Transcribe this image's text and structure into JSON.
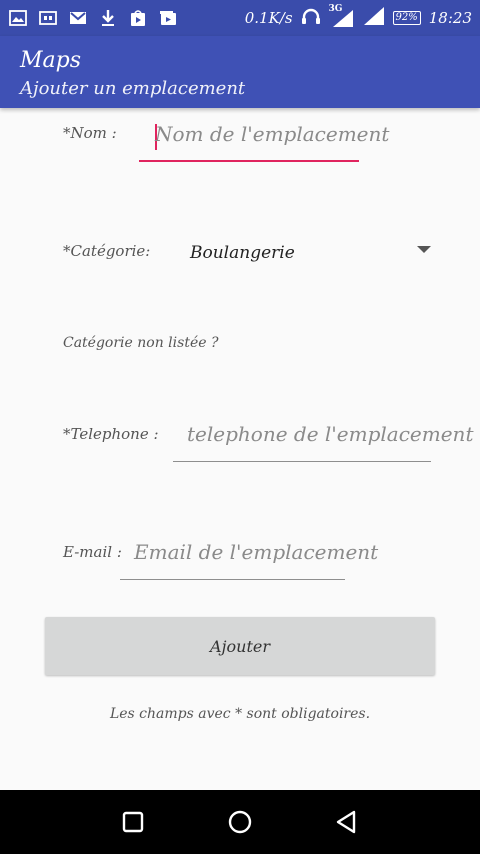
{
  "status_bar": {
    "network_speed": "0.1K/s",
    "network_type": "3G",
    "battery": "92%",
    "time": "18:23",
    "icons": [
      "image-icon",
      "cast-icon",
      "gmail-icon",
      "download-icon",
      "store-icon",
      "gallery-icon",
      "headphones-icon",
      "signal-icon",
      "signal-icon-2",
      "battery-icon"
    ]
  },
  "app_bar": {
    "title": "Maps",
    "subtitle": "Ajouter un emplacement"
  },
  "form": {
    "name": {
      "label": "*Nom :",
      "placeholder": "Nom de l'emplacement"
    },
    "category": {
      "label": "*Catégorie:",
      "selected": "Boulangerie"
    },
    "category_unlisted": "Catégorie non listée ?",
    "phone": {
      "label": "*Telephone :",
      "placeholder": "telephone de l'emplacement"
    },
    "email": {
      "label": "E-mail :",
      "placeholder": "Email de l'emplacement"
    },
    "submit_label": "Ajouter",
    "required_note": "Les champs avec * sont obligatoires."
  },
  "nav_bar": {
    "buttons": [
      "recents-button",
      "home-button",
      "back-button"
    ]
  }
}
